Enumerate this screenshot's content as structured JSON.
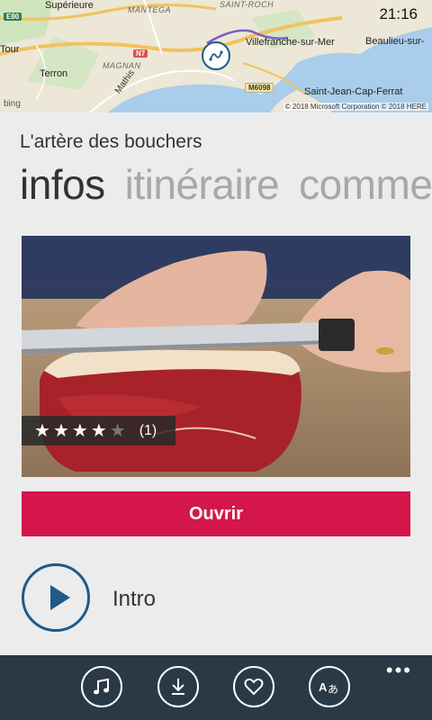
{
  "status_bar": {
    "time": "21:16"
  },
  "map": {
    "labels": {
      "superieure": "Supérieure",
      "mantega": "MANTEGA",
      "saint_roch": "SAINT-ROCH",
      "tour": "Tour",
      "villefranche": "Villefranche-sur-Mer",
      "beaulieu": "Beaulieu-sur-",
      "terron": "Terron",
      "magnan": "MAGNAN",
      "mathis": "Mathis",
      "saint_jean": "Saint-Jean-Cap-Ferrat",
      "e80": "E80",
      "n7": "N7",
      "m6098": "M6098"
    },
    "bing": "bing",
    "copyright": "© 2018 Microsoft Corporation © 2018 HERE"
  },
  "header": {
    "title": "L'artère des bouchers"
  },
  "pivot": {
    "tabs": [
      {
        "label": "infos"
      },
      {
        "label": "itinéraire"
      },
      {
        "label": "comme"
      }
    ]
  },
  "rating": {
    "stars_filled": 4,
    "stars_total": 5,
    "count": "(1)"
  },
  "actions": {
    "open_label": "Ouvrir"
  },
  "audio": {
    "label": "Intro"
  },
  "app_bar": {
    "icons": [
      "music-icon",
      "download-icon",
      "heart-icon",
      "translate-icon"
    ],
    "more": "•••"
  },
  "colors": {
    "accent_red": "#d4164a",
    "accent_blue": "#1e5a8a",
    "app_bar_bg": "#2b3846"
  }
}
